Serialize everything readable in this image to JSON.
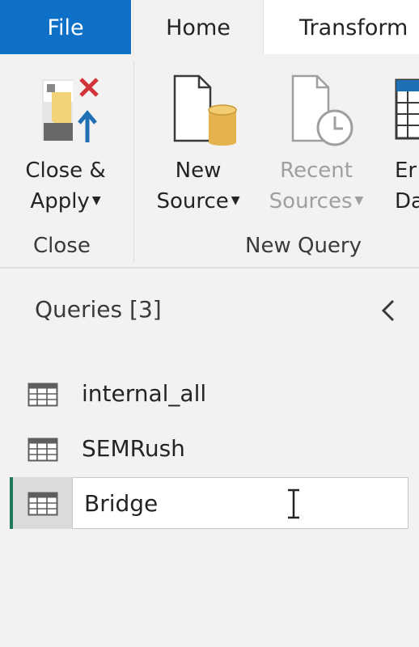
{
  "tabs": {
    "file": "File",
    "home": "Home",
    "transform": "Transform"
  },
  "ribbon": {
    "close_apply": {
      "line1": "Close &",
      "line2": "Apply",
      "icon": "close-apply-icon"
    },
    "new_source": {
      "line1": "New",
      "line2": "Source",
      "icon": "new-source-icon"
    },
    "recent_sources": {
      "line1": "Recent",
      "line2": "Sources",
      "icon": "recent-sources-icon",
      "disabled": true
    },
    "enter_data": {
      "line1": "Er",
      "line2": "Da",
      "icon": "enter-data-icon"
    },
    "groups": {
      "close": "Close",
      "new_query": "New Query"
    }
  },
  "queries": {
    "title": "Queries [3]",
    "items": [
      {
        "label": "internal_all",
        "icon": "table-icon"
      },
      {
        "label": "SEMRush",
        "icon": "table-icon"
      },
      {
        "label": "Bridge",
        "icon": "table-icon",
        "selected": true,
        "editing": true
      }
    ]
  },
  "colors": {
    "file_tab": "#0f70c7",
    "selection_accent": "#1f7a5a",
    "background": "#f3f2f1"
  }
}
